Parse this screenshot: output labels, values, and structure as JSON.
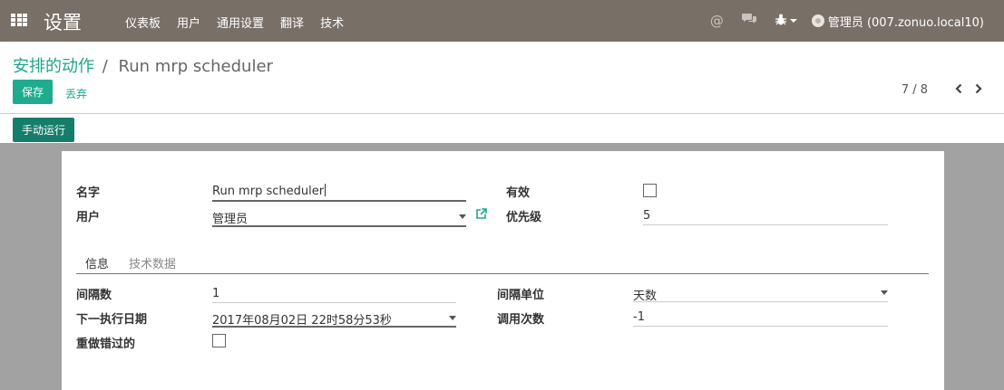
{
  "navbar": {
    "title": "设置",
    "menu": [
      "仪表板",
      "用户",
      "通用设置",
      "翻译",
      "技术"
    ],
    "user": "管理员 (007.zonuo.local10)"
  },
  "breadcrumb": {
    "parent": "安排的动作",
    "separator": "/",
    "current": "Run mrp scheduler"
  },
  "buttons": {
    "save": "保存",
    "discard": "丢弃",
    "run_manually": "手动运行"
  },
  "pager": {
    "value": "7 / 8"
  },
  "form": {
    "name_label": "名字",
    "name_value": "Run mrp scheduler",
    "user_label": "用户",
    "user_value": "管理员",
    "active_label": "有效",
    "active_checked": false,
    "priority_label": "优先级",
    "priority_value": "5"
  },
  "tabs": [
    "信息",
    "技术数据"
  ],
  "info": {
    "interval_number_label": "间隔数",
    "interval_number_value": "1",
    "next_exec_label": "下一执行日期",
    "next_exec_value": "2017年08月02日 22时58分53秒",
    "doall_label": "重做错过的",
    "doall_checked": false,
    "interval_type_label": "间隔单位",
    "interval_type_value": "天数",
    "numbercall_label": "调用次数",
    "numbercall_value": "-1"
  },
  "colors": {
    "navbar": "#787067",
    "accent": "#1fa58a",
    "run_button": "#157e6a"
  }
}
